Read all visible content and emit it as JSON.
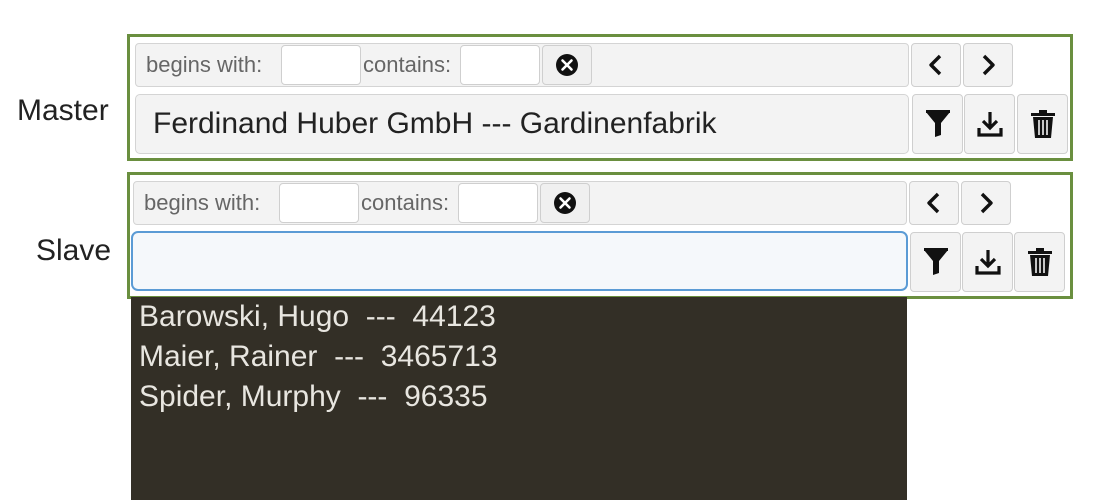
{
  "master": {
    "label": "Master",
    "filter": {
      "begins_with_label": "begins with:",
      "begins_with_value": "",
      "contains_label": "contains:",
      "contains_value": ""
    },
    "value": "Ferdinand Huber GmbH  ---  Gardinenfabrik"
  },
  "slave": {
    "label": "Slave",
    "filter": {
      "begins_with_label": "begins with:",
      "begins_with_value": "",
      "contains_label": "contains:",
      "contains_value": ""
    },
    "value": "",
    "options": [
      "Barowski, Hugo  ---  44123",
      "Maier, Rainer  ---  3465713",
      "Spider, Murphy  ---  96335"
    ]
  },
  "icons": {
    "clear": "circle-x-icon",
    "prev": "chevron-left-icon",
    "next": "chevron-right-icon",
    "filter": "funnel-icon",
    "download": "download-icon",
    "delete": "trash-icon"
  },
  "colors": {
    "panel_border": "#6a8f3f",
    "focus_border": "#5b9bd5",
    "dropdown_bg": "#332f26"
  }
}
